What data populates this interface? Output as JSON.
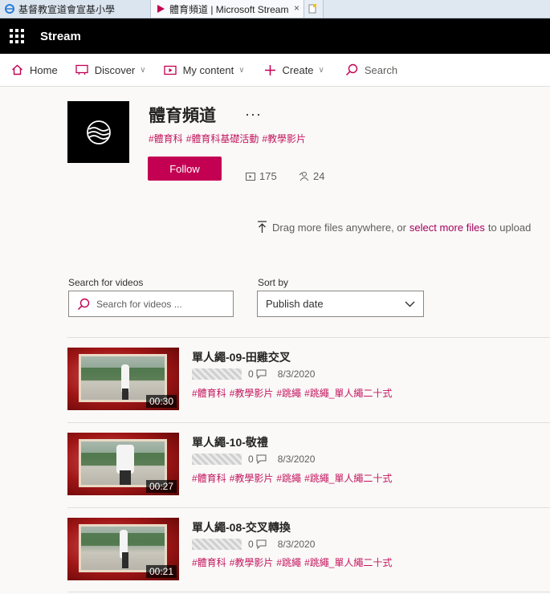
{
  "browser": {
    "tabs": [
      {
        "label": "基督教宣道會宣基小學"
      },
      {
        "label": "體育頻道 | Microsoft Stream",
        "close": "×"
      },
      {
        "label": ""
      }
    ]
  },
  "app": {
    "name": "Stream"
  },
  "nav": {
    "home": "Home",
    "discover": "Discover",
    "my_content": "My content",
    "create": "Create",
    "search": "Search"
  },
  "channel": {
    "title": "體育頻道",
    "more": "···",
    "tags": [
      "#體育科",
      "#體育科基礎活動",
      "#教學影片"
    ],
    "follow_label": "Follow",
    "video_count": "175",
    "follower_count": "24"
  },
  "upload": {
    "prefix": "Drag more files anywhere, or",
    "link": "select more files",
    "suffix": "to upload"
  },
  "filter": {
    "search_label": "Search for videos",
    "search_placeholder": "Search for videos ...",
    "sort_label": "Sort by",
    "sort_value": "Publish date"
  },
  "videos": [
    {
      "title": "單人繩-09-田雞交叉",
      "duration": "00:30",
      "comments": "0",
      "date": "8/3/2020",
      "tags": [
        "#體育科",
        "#教學影片",
        "#跳繩",
        "#跳繩_單人繩二十式"
      ]
    },
    {
      "title": "單人繩-10-敬禮",
      "duration": "00:27",
      "comments": "0",
      "date": "8/3/2020",
      "tags": [
        "#體育科",
        "#教學影片",
        "#跳繩",
        "#跳繩_單人繩二十式"
      ]
    },
    {
      "title": "單人繩-08-交叉轉換",
      "duration": "00:21",
      "comments": "0",
      "date": "8/3/2020",
      "tags": [
        "#體育科",
        "#教學影片",
        "#跳繩",
        "#跳繩_單人繩二十式"
      ]
    }
  ],
  "colors": {
    "accent": "#c30052",
    "tag": "#c4175f",
    "appbar": "#000000"
  }
}
